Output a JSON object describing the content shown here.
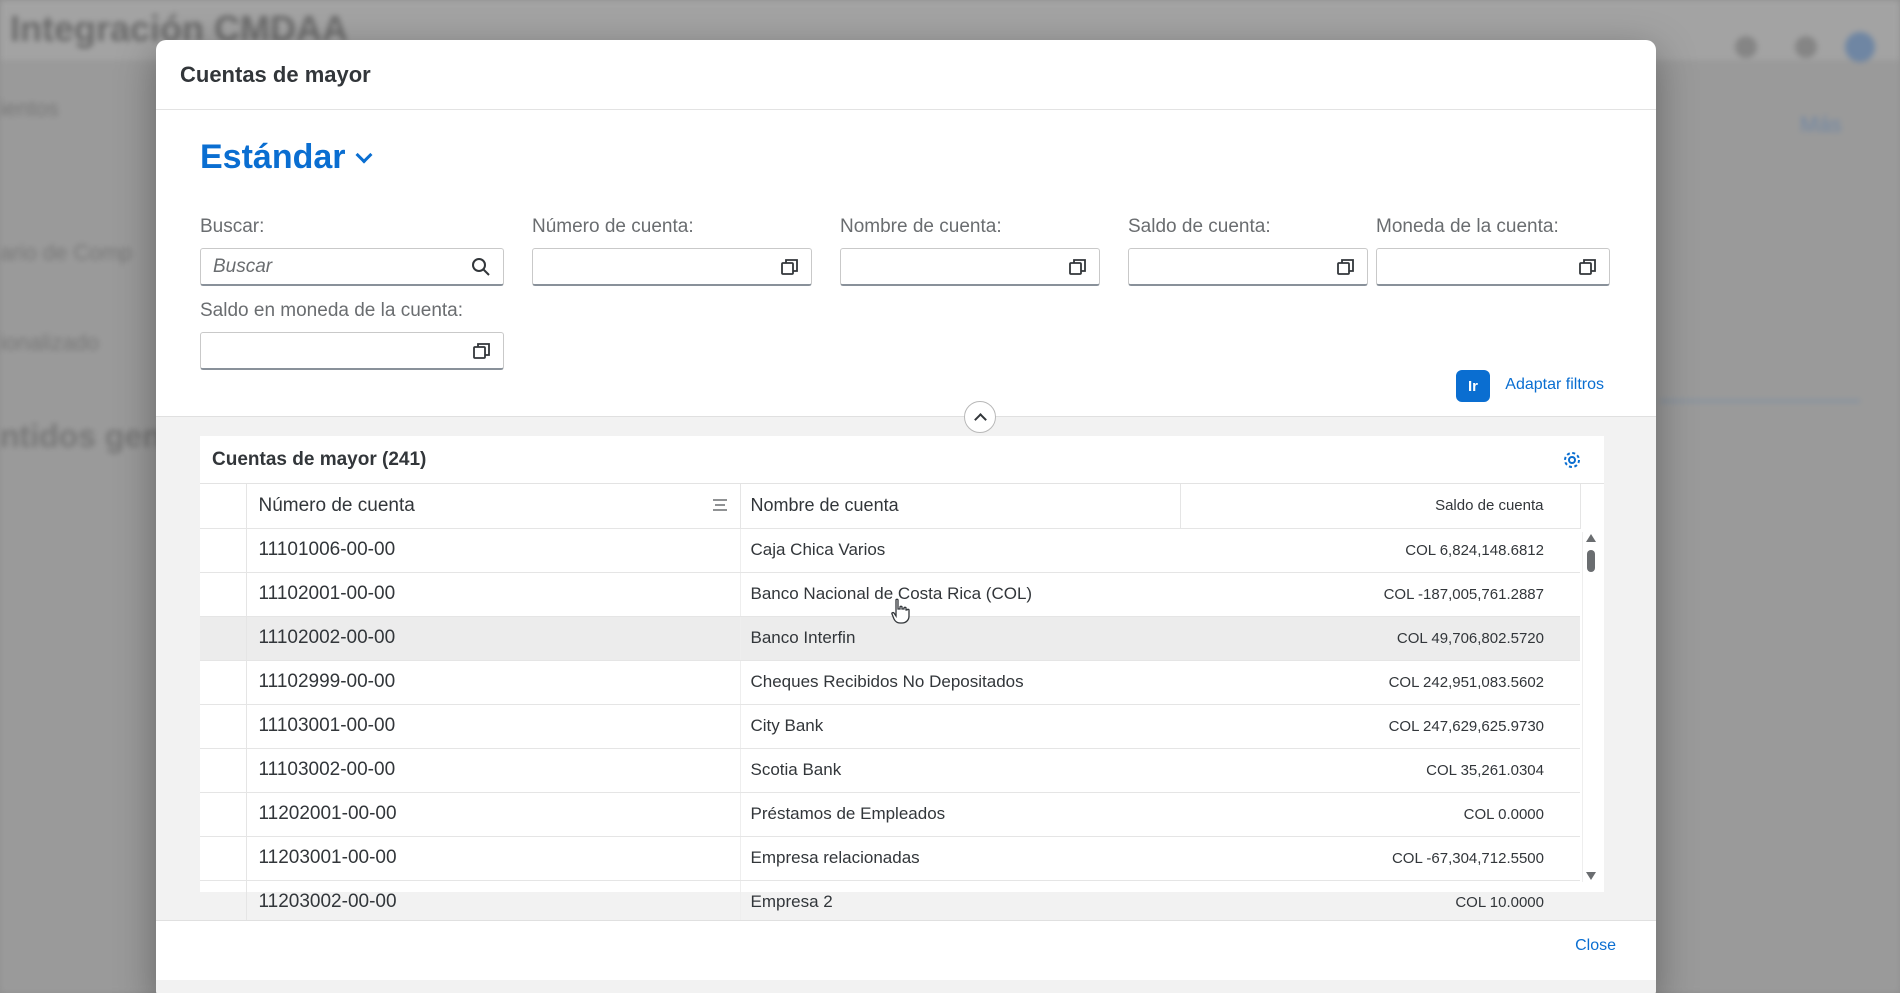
{
  "background": {
    "app_title": "Integración CMDAA",
    "left_texts": [
      "ientos",
      "ario de Comp",
      "ionalizado",
      "ntidos gen"
    ],
    "right_link": "Más"
  },
  "dialog": {
    "title": "Cuentas de mayor",
    "variant": "Estándar",
    "close_label": "Close"
  },
  "filters": {
    "search": {
      "label": "Buscar:",
      "placeholder": "Buscar",
      "value": ""
    },
    "account_number": {
      "label": "Número de cuenta:",
      "value": ""
    },
    "account_name": {
      "label": "Nombre de cuenta:",
      "value": ""
    },
    "account_balance": {
      "label": "Saldo de cuenta:",
      "value": ""
    },
    "account_currency": {
      "label": "Moneda de la cuenta:",
      "value": ""
    },
    "balance_in_currency": {
      "label": "Saldo en moneda de la cuenta:",
      "value": ""
    },
    "go_label": "Ir",
    "adapt_label": "Adaptar filtros"
  },
  "table": {
    "title": "Cuentas de mayor (241)",
    "columns": [
      "Número de cuenta",
      "Nombre de cuenta",
      "Saldo de cuenta"
    ],
    "rows": [
      {
        "number": "11101006-00-00",
        "name": "Caja Chica Varios",
        "balance": "COL 6,824,148.6812"
      },
      {
        "number": "11102001-00-00",
        "name": "Banco Nacional de Costa Rica (COL)",
        "balance": "COL -187,005,761.2887"
      },
      {
        "number": "11102002-00-00",
        "name": "Banco Interfin",
        "balance": "COL 49,706,802.5720"
      },
      {
        "number": "11102999-00-00",
        "name": "Cheques Recibidos No Depositados",
        "balance": "COL 242,951,083.5602"
      },
      {
        "number": "11103001-00-00",
        "name": "City Bank",
        "balance": "COL 247,629,625.9730"
      },
      {
        "number": "11103002-00-00",
        "name": "Scotia Bank",
        "balance": "COL 35,261.0304"
      },
      {
        "number": "11202001-00-00",
        "name": "Préstamos de Empleados",
        "balance": "COL 0.0000"
      },
      {
        "number": "11203001-00-00",
        "name": "Empresa relacionadas",
        "balance": "COL -67,304,712.5500"
      },
      {
        "number": "11203002-00-00",
        "name": "Empresa 2",
        "balance": "COL 10.0000"
      }
    ],
    "hover_row_index": 2
  },
  "colors": {
    "accent": "#0a6ed1",
    "text": "#32363a",
    "muted": "#6a6d70"
  }
}
